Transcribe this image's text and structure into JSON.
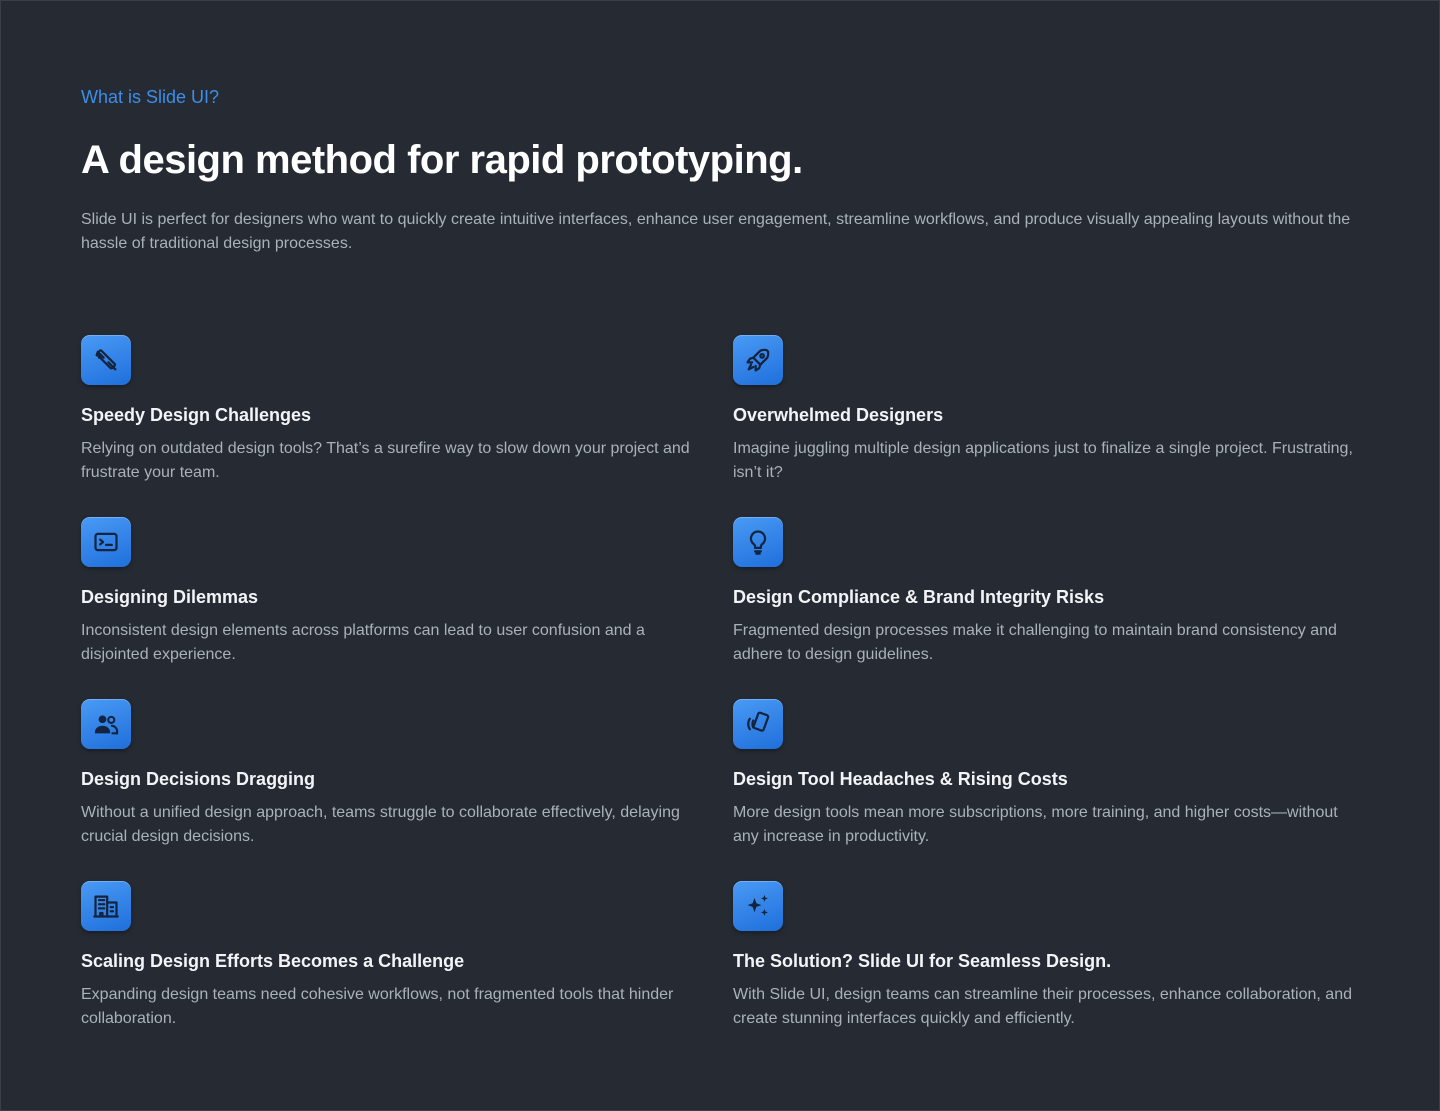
{
  "section": {
    "eyebrow": "What is Slide UI?",
    "headline": "A design method for rapid prototyping.",
    "intro": "Slide UI is perfect for designers who want to quickly create intuitive interfaces, enhance user engagement, streamline workflows, and produce visually appealing layouts without the hassle of traditional design processes."
  },
  "colors": {
    "background": "#262b33",
    "accent": "#3b8eea",
    "icon_tile": "#2a7ae6",
    "title": "#f2f4f7",
    "body_text": "#aab1bb"
  },
  "features": [
    {
      "icon": "design-tools-icon",
      "title": "Speedy Design Challenges",
      "description": "Relying on outdated design tools? That’s a surefire way to slow down your project and frustrate your team."
    },
    {
      "icon": "rocket-icon",
      "title": "Overwhelmed Designers",
      "description": " Imagine juggling multiple design applications just to finalize a single project. Frustrating, isn’t it?"
    },
    {
      "icon": "terminal-window-icon",
      "title": "Designing Dilemmas",
      "description": "Inconsistent design elements across platforms can lead to user confusion and a disjointed experience."
    },
    {
      "icon": "lightbulb-icon",
      "title": "Design Compliance & Brand Integrity Risks",
      "description": "Fragmented design processes make it challenging to maintain brand consistency and adhere to design guidelines."
    },
    {
      "icon": "people-icon",
      "title": "Design Decisions Dragging",
      "description": "Without a unified design approach, teams struggle to collaborate effectively, delaying crucial design decisions."
    },
    {
      "icon": "contactless-card-icon",
      "title": "Design Tool Headaches & Rising Costs",
      "description": "More design tools mean more subscriptions, more training, and higher costs—without any increase in productivity."
    },
    {
      "icon": "building-icon",
      "title": "Scaling Design Efforts Becomes a Challenge",
      "description": "Expanding design teams need cohesive workflows, not fragmented tools that hinder collaboration."
    },
    {
      "icon": "sparkles-icon",
      "title": "The Solution? Slide UI for Seamless Design.",
      "description": "With Slide UI, design teams can streamline their processes, enhance collaboration, and create stunning interfaces quickly and efficiently."
    }
  ]
}
